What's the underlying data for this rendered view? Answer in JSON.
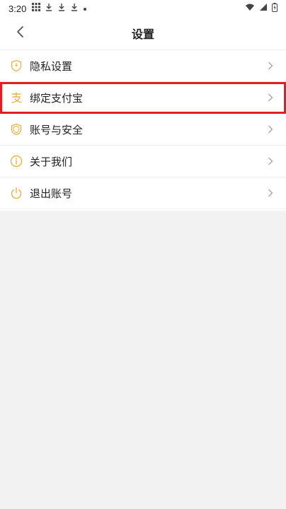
{
  "status_bar": {
    "time": "3:20",
    "left_icons": [
      "grid-icon",
      "download-icon",
      "download-icon",
      "download-icon",
      "dot-icon"
    ],
    "right_icons": [
      "wifi-icon",
      "signal-icon",
      "battery-icon"
    ]
  },
  "header": {
    "title": "设置",
    "back_icon": "chevron-left-icon"
  },
  "settings": {
    "items": [
      {
        "label": "隐私设置",
        "icon": "privacy-shield-icon"
      },
      {
        "label": "绑定支付宝",
        "icon": "alipay-icon",
        "highlighted": true
      },
      {
        "label": "账号与安全",
        "icon": "security-shield-icon"
      },
      {
        "label": "关于我们",
        "icon": "info-icon"
      },
      {
        "label": "退出账号",
        "icon": "power-icon"
      }
    ]
  },
  "colors": {
    "accent": "#E7B34A",
    "highlight": "#E02020",
    "divider": "#F0F0F0",
    "background_gray": "#F2F2F2"
  }
}
